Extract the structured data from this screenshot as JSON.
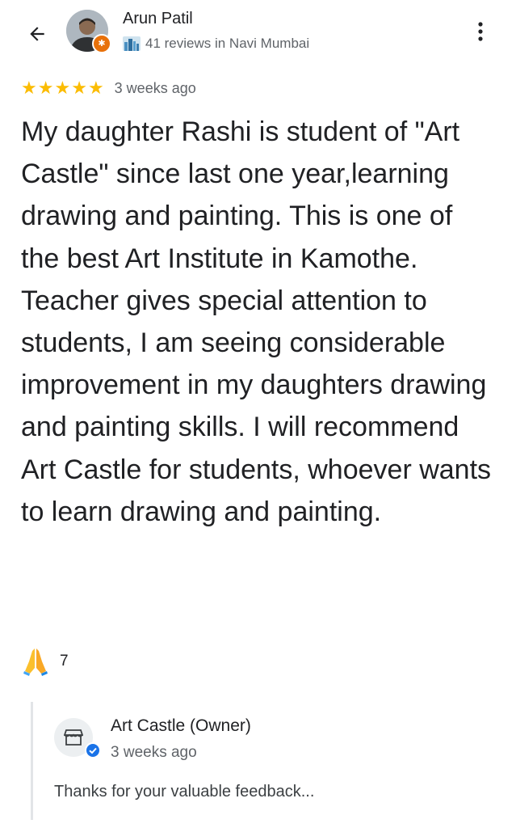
{
  "user": {
    "name": "Arun Patil",
    "meta": "41 reviews in Navi Mumbai"
  },
  "review": {
    "rating": 5,
    "time": "3 weeks ago",
    "text": "My daughter Rashi is student of \"Art Castle\" since last one year,learning drawing and painting. This is one of the best Art Institute in Kamothe. Teacher gives special attention to students, I am seeing considerable improvement in my daughters drawing and painting skills. I will recommend Art Castle for students, whoever wants to learn drawing and painting."
  },
  "reaction": {
    "icon": "praying-hands-icon",
    "count": "7"
  },
  "owner": {
    "name": "Art Castle (Owner)",
    "time": "3 weeks ago",
    "reply": "Thanks for your valuable feedback..."
  },
  "colors": {
    "star": "#fbbc04",
    "local_guide_badge": "#e8710a",
    "verified": "#1a73e8",
    "divider": "#e2e4e7"
  }
}
